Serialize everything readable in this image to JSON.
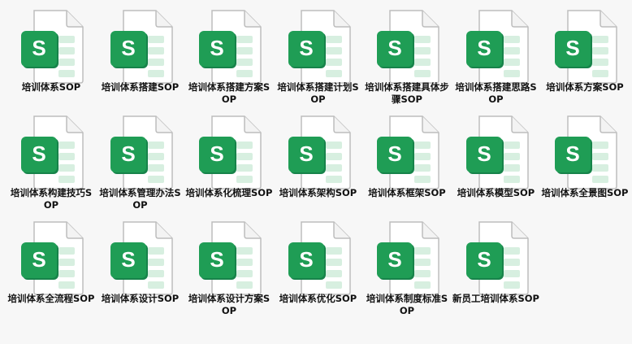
{
  "colors": {
    "background": "#f7f7f7",
    "badge_dark": "#17834a",
    "badge": "#1f9d55",
    "sheet_stripe": "#d7efe0",
    "page": "#ffffff",
    "page_border": "#bdbdbd"
  },
  "file_icon": "sway-document-icon",
  "badge_letter": "S",
  "files": [
    {
      "name": "培训体系SOP"
    },
    {
      "name": "培训体系搭建SOP"
    },
    {
      "name": "培训体系搭建方案SOP"
    },
    {
      "name": "培训体系搭建计划SOP"
    },
    {
      "name": "培训体系搭建具体步骤SOP"
    },
    {
      "name": "培训体系搭建思路SOP"
    },
    {
      "name": "培训体系方案SOP"
    },
    {
      "name": "培训体系构建技巧SOP"
    },
    {
      "name": "培训体系管理办法SOP"
    },
    {
      "name": "培训体系化梳理SOP"
    },
    {
      "name": "培训体系架构SOP"
    },
    {
      "name": "培训体系框架SOP"
    },
    {
      "name": "培训体系模型SOP"
    },
    {
      "name": "培训体系全景图SOP"
    },
    {
      "name": "培训体系全流程SOP"
    },
    {
      "name": "培训体系设计SOP"
    },
    {
      "name": "培训体系设计方案SOP"
    },
    {
      "name": "培训体系优化SOP"
    },
    {
      "name": "培训体系制度标准SOP"
    },
    {
      "name": "新员工培训体系SOP"
    }
  ]
}
